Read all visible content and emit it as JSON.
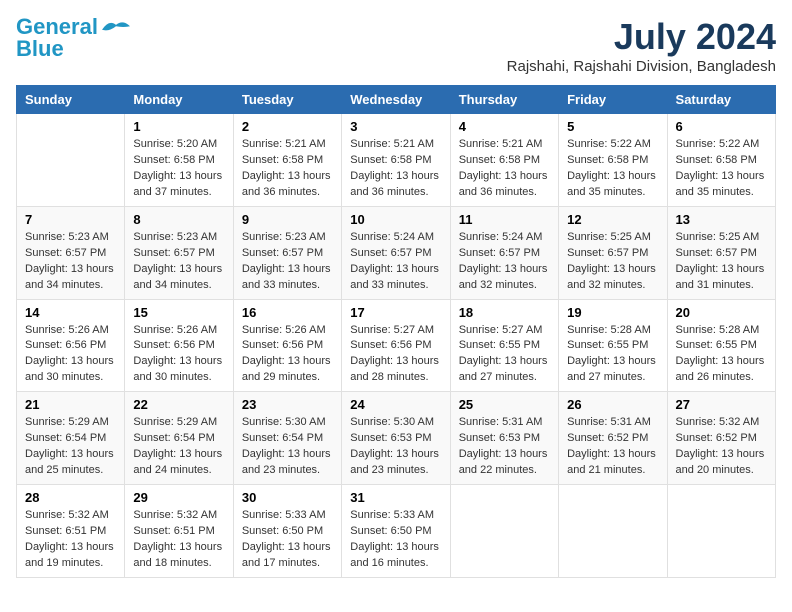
{
  "logo": {
    "general": "General",
    "blue": "Blue"
  },
  "header": {
    "month_year": "July 2024",
    "location": "Rajshahi, Rajshahi Division, Bangladesh"
  },
  "weekdays": [
    "Sunday",
    "Monday",
    "Tuesday",
    "Wednesday",
    "Thursday",
    "Friday",
    "Saturday"
  ],
  "weeks": [
    [
      {
        "day": "",
        "content": ""
      },
      {
        "day": "1",
        "content": "Sunrise: 5:20 AM\nSunset: 6:58 PM\nDaylight: 13 hours\nand 37 minutes."
      },
      {
        "day": "2",
        "content": "Sunrise: 5:21 AM\nSunset: 6:58 PM\nDaylight: 13 hours\nand 36 minutes."
      },
      {
        "day": "3",
        "content": "Sunrise: 5:21 AM\nSunset: 6:58 PM\nDaylight: 13 hours\nand 36 minutes."
      },
      {
        "day": "4",
        "content": "Sunrise: 5:21 AM\nSunset: 6:58 PM\nDaylight: 13 hours\nand 36 minutes."
      },
      {
        "day": "5",
        "content": "Sunrise: 5:22 AM\nSunset: 6:58 PM\nDaylight: 13 hours\nand 35 minutes."
      },
      {
        "day": "6",
        "content": "Sunrise: 5:22 AM\nSunset: 6:58 PM\nDaylight: 13 hours\nand 35 minutes."
      }
    ],
    [
      {
        "day": "7",
        "content": "Sunrise: 5:23 AM\nSunset: 6:57 PM\nDaylight: 13 hours\nand 34 minutes."
      },
      {
        "day": "8",
        "content": "Sunrise: 5:23 AM\nSunset: 6:57 PM\nDaylight: 13 hours\nand 34 minutes."
      },
      {
        "day": "9",
        "content": "Sunrise: 5:23 AM\nSunset: 6:57 PM\nDaylight: 13 hours\nand 33 minutes."
      },
      {
        "day": "10",
        "content": "Sunrise: 5:24 AM\nSunset: 6:57 PM\nDaylight: 13 hours\nand 33 minutes."
      },
      {
        "day": "11",
        "content": "Sunrise: 5:24 AM\nSunset: 6:57 PM\nDaylight: 13 hours\nand 32 minutes."
      },
      {
        "day": "12",
        "content": "Sunrise: 5:25 AM\nSunset: 6:57 PM\nDaylight: 13 hours\nand 32 minutes."
      },
      {
        "day": "13",
        "content": "Sunrise: 5:25 AM\nSunset: 6:57 PM\nDaylight: 13 hours\nand 31 minutes."
      }
    ],
    [
      {
        "day": "14",
        "content": "Sunrise: 5:26 AM\nSunset: 6:56 PM\nDaylight: 13 hours\nand 30 minutes."
      },
      {
        "day": "15",
        "content": "Sunrise: 5:26 AM\nSunset: 6:56 PM\nDaylight: 13 hours\nand 30 minutes."
      },
      {
        "day": "16",
        "content": "Sunrise: 5:26 AM\nSunset: 6:56 PM\nDaylight: 13 hours\nand 29 minutes."
      },
      {
        "day": "17",
        "content": "Sunrise: 5:27 AM\nSunset: 6:56 PM\nDaylight: 13 hours\nand 28 minutes."
      },
      {
        "day": "18",
        "content": "Sunrise: 5:27 AM\nSunset: 6:55 PM\nDaylight: 13 hours\nand 27 minutes."
      },
      {
        "day": "19",
        "content": "Sunrise: 5:28 AM\nSunset: 6:55 PM\nDaylight: 13 hours\nand 27 minutes."
      },
      {
        "day": "20",
        "content": "Sunrise: 5:28 AM\nSunset: 6:55 PM\nDaylight: 13 hours\nand 26 minutes."
      }
    ],
    [
      {
        "day": "21",
        "content": "Sunrise: 5:29 AM\nSunset: 6:54 PM\nDaylight: 13 hours\nand 25 minutes."
      },
      {
        "day": "22",
        "content": "Sunrise: 5:29 AM\nSunset: 6:54 PM\nDaylight: 13 hours\nand 24 minutes."
      },
      {
        "day": "23",
        "content": "Sunrise: 5:30 AM\nSunset: 6:54 PM\nDaylight: 13 hours\nand 23 minutes."
      },
      {
        "day": "24",
        "content": "Sunrise: 5:30 AM\nSunset: 6:53 PM\nDaylight: 13 hours\nand 23 minutes."
      },
      {
        "day": "25",
        "content": "Sunrise: 5:31 AM\nSunset: 6:53 PM\nDaylight: 13 hours\nand 22 minutes."
      },
      {
        "day": "26",
        "content": "Sunrise: 5:31 AM\nSunset: 6:52 PM\nDaylight: 13 hours\nand 21 minutes."
      },
      {
        "day": "27",
        "content": "Sunrise: 5:32 AM\nSunset: 6:52 PM\nDaylight: 13 hours\nand 20 minutes."
      }
    ],
    [
      {
        "day": "28",
        "content": "Sunrise: 5:32 AM\nSunset: 6:51 PM\nDaylight: 13 hours\nand 19 minutes."
      },
      {
        "day": "29",
        "content": "Sunrise: 5:32 AM\nSunset: 6:51 PM\nDaylight: 13 hours\nand 18 minutes."
      },
      {
        "day": "30",
        "content": "Sunrise: 5:33 AM\nSunset: 6:50 PM\nDaylight: 13 hours\nand 17 minutes."
      },
      {
        "day": "31",
        "content": "Sunrise: 5:33 AM\nSunset: 6:50 PM\nDaylight: 13 hours\nand 16 minutes."
      },
      {
        "day": "",
        "content": ""
      },
      {
        "day": "",
        "content": ""
      },
      {
        "day": "",
        "content": ""
      }
    ]
  ]
}
